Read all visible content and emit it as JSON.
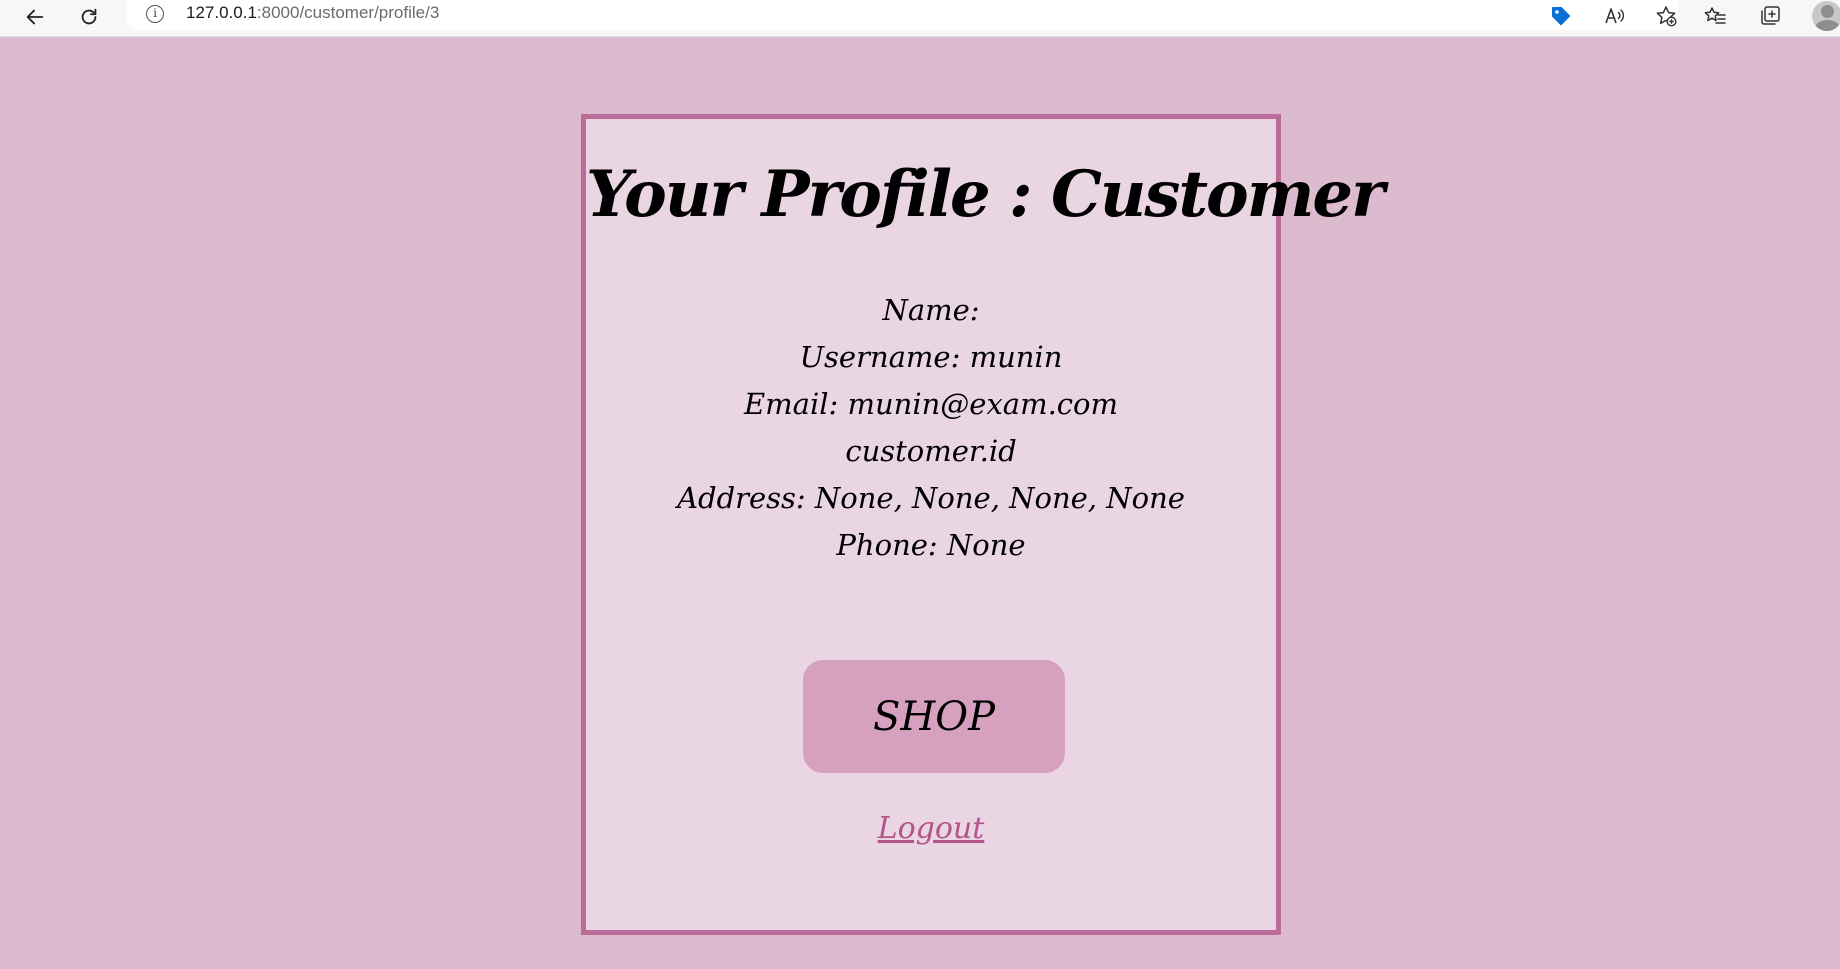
{
  "browser": {
    "url_host": "127.0.0.1",
    "url_path": ":8000/customer/profile/3",
    "info_icon": "i",
    "icons": {
      "back": "back-arrow-icon",
      "reload": "reload-icon",
      "site_info": "info-icon",
      "extension": "tag-icon",
      "read_aloud": "read-aloud-icon",
      "add_favorite": "star-add-icon",
      "favorites": "favorites-icon",
      "collections": "collections-icon",
      "profile": "avatar"
    },
    "accent_color": "#0a6fd6"
  },
  "page": {
    "background_color": "#ddbbcf",
    "card_color": "#ead5e2",
    "card_border_color": "#b96d98",
    "title": "Your Profile : Customer",
    "details": {
      "name": "Name:",
      "username": "Username: munin",
      "email": "Email: munin@exam.com",
      "customer_id": "customer.id",
      "address": "Address: None, None, None, None",
      "phone": "Phone: None"
    },
    "shop_button_label": "SHOP",
    "shop_button_color": "#d5a1be",
    "logout_label": "Logout",
    "logout_color": "#b3548a"
  }
}
